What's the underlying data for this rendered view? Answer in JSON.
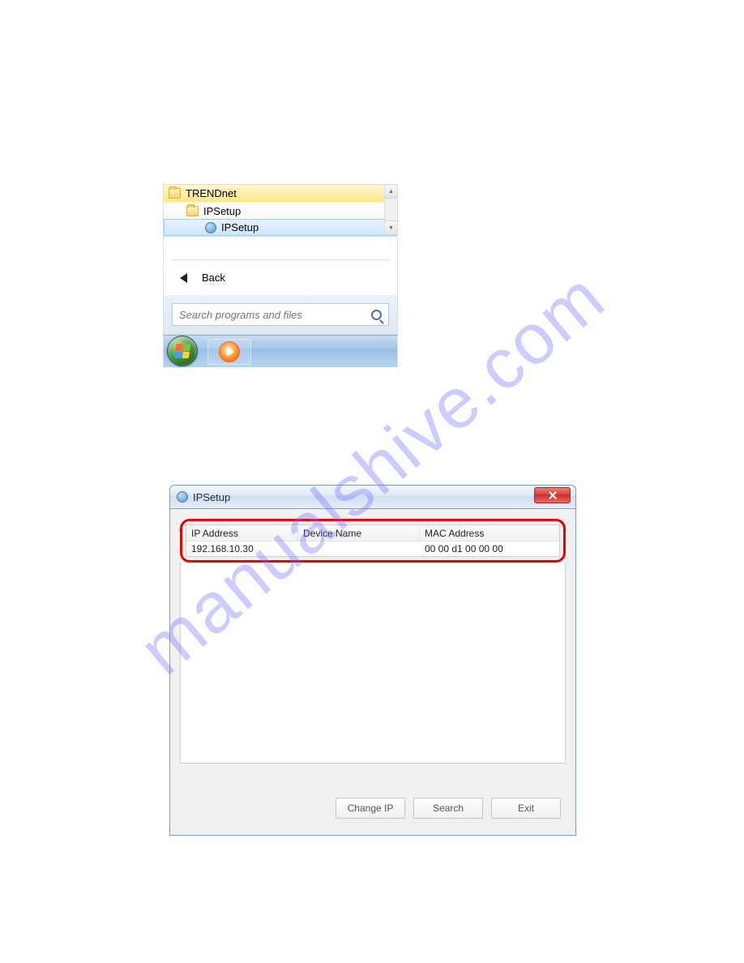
{
  "watermark": "manualshive.com",
  "startmenu": {
    "items": {
      "root": "TRENDnet",
      "sub": "IPSetup",
      "leaf": "IPSetup"
    },
    "back_label": "Back",
    "search_placeholder": "Search programs and files"
  },
  "ipsetup": {
    "title": "IPSetup",
    "headers": {
      "ip": "IP Address",
      "device": "Device Name",
      "mac": "MAC Address"
    },
    "row": {
      "ip": "192.168.10.30",
      "device": "",
      "mac": "00 00 d1 00 00 00"
    },
    "buttons": {
      "change_ip": "Change IP",
      "search": "Search",
      "exit": "Exit"
    }
  }
}
